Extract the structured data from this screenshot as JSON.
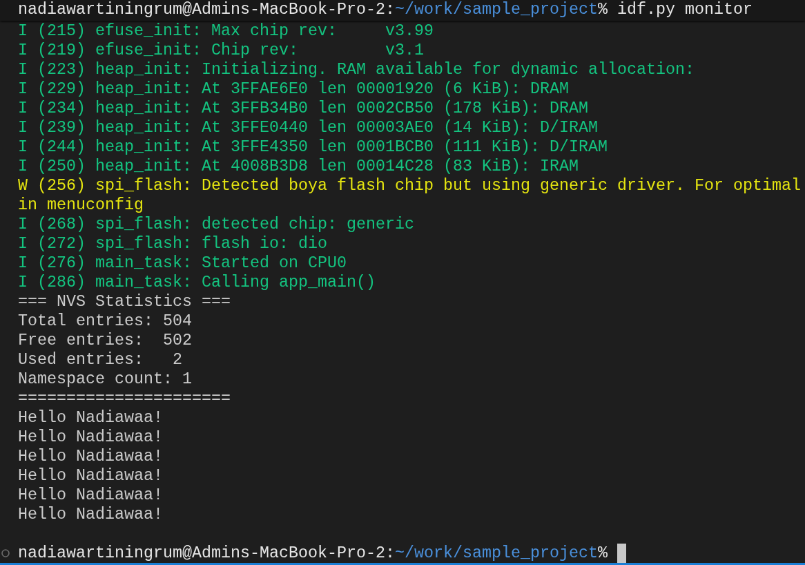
{
  "sticky_header": {
    "user_host": "nadiawartiningrum@Admins-MacBook-Pro-2:",
    "path": "~/work/sample_project",
    "prompt_symbol": "%",
    "command": "idf.py monitor"
  },
  "output": [
    {
      "kind": "info",
      "text": "I (215) efuse_init: Max chip rev:     v3.99"
    },
    {
      "kind": "info",
      "text": "I (219) efuse_init: Chip rev:         v3.1"
    },
    {
      "kind": "info",
      "text": "I (223) heap_init: Initializing. RAM available for dynamic allocation:"
    },
    {
      "kind": "info",
      "text": "I (229) heap_init: At 3FFAE6E0 len 00001920 (6 KiB): DRAM"
    },
    {
      "kind": "info",
      "text": "I (234) heap_init: At 3FFB34B0 len 0002CB50 (178 KiB): DRAM"
    },
    {
      "kind": "info",
      "text": "I (239) heap_init: At 3FFE0440 len 00003AE0 (14 KiB): D/IRAM"
    },
    {
      "kind": "info",
      "text": "I (244) heap_init: At 3FFE4350 len 0001BCB0 (111 KiB): D/IRAM"
    },
    {
      "kind": "info",
      "text": "I (250) heap_init: At 4008B3D8 len 00014C28 (83 KiB): IRAM"
    },
    {
      "kind": "warning",
      "text": "W (256) spi_flash: Detected boya flash chip but using generic driver. For optimal"
    },
    {
      "kind": "warning",
      "text": "in menuconfig"
    },
    {
      "kind": "info",
      "text": "I (268) spi_flash: detected chip: generic"
    },
    {
      "kind": "info",
      "text": "I (272) spi_flash: flash io: dio"
    },
    {
      "kind": "info",
      "text": "I (276) main_task: Started on CPU0"
    },
    {
      "kind": "info",
      "text": "I (286) main_task: Calling app_main()"
    },
    {
      "kind": "plain",
      "text": "=== NVS Statistics ==="
    },
    {
      "kind": "plain",
      "text": "Total entries: 504"
    },
    {
      "kind": "plain",
      "text": "Free entries:  502"
    },
    {
      "kind": "plain",
      "text": "Used entries:   2"
    },
    {
      "kind": "plain",
      "text": "Namespace count: 1"
    },
    {
      "kind": "plain",
      "text": "======================"
    },
    {
      "kind": "plain",
      "text": "Hello Nadiawaa!"
    },
    {
      "kind": "plain",
      "text": "Hello Nadiawaa!"
    },
    {
      "kind": "plain",
      "text": "Hello Nadiawaa!"
    },
    {
      "kind": "plain",
      "text": "Hello Nadiawaa!"
    },
    {
      "kind": "plain",
      "text": "Hello Nadiawaa!"
    },
    {
      "kind": "plain",
      "text": "Hello Nadiawaa!"
    }
  ],
  "prompt": {
    "user_host": "nadiawartiningrum@Admins-MacBook-Pro-2:",
    "path": "~/work/sample_project",
    "prompt_symbol": "%",
    "cursor": true
  }
}
